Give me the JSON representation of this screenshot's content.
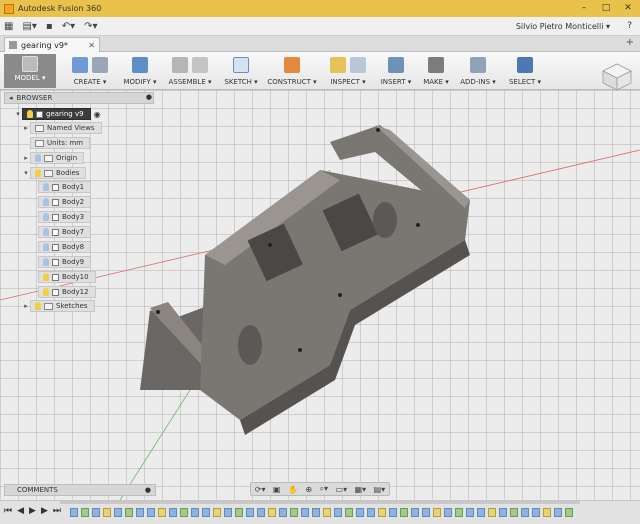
{
  "window": {
    "title": "Autodesk Fusion 360"
  },
  "qat": {
    "user": "Silvio Pietro Monticelli ▾",
    "help": "?"
  },
  "doc_tab": {
    "label": "gearing v9*"
  },
  "ribbon": {
    "workspace": "MODEL ▾",
    "groups": [
      "CREATE ▾",
      "MODIFY ▾",
      "ASSEMBLE ▾",
      "SKETCH ▾",
      "CONSTRUCT ▾",
      "INSPECT ▾",
      "INSERT ▾",
      "MAKE ▾",
      "ADD-INS ▾",
      "SELECT ▾"
    ]
  },
  "browser": {
    "header": "BROWSER",
    "root": "gearing v9",
    "named_views": "Named Views",
    "units": "Units: mm",
    "origin": "Origin",
    "bodies": "Bodies",
    "body_items": [
      "Body1",
      "Body2",
      "Body3",
      "Body7",
      "Body8",
      "Body9",
      "Body10",
      "Body12"
    ],
    "sketches": "Sketches"
  },
  "comments": {
    "label": "COMMENTS"
  },
  "colors": {
    "title_bar": "#e8c24a",
    "model": "#7a7672",
    "select": "#4a7ab0"
  }
}
